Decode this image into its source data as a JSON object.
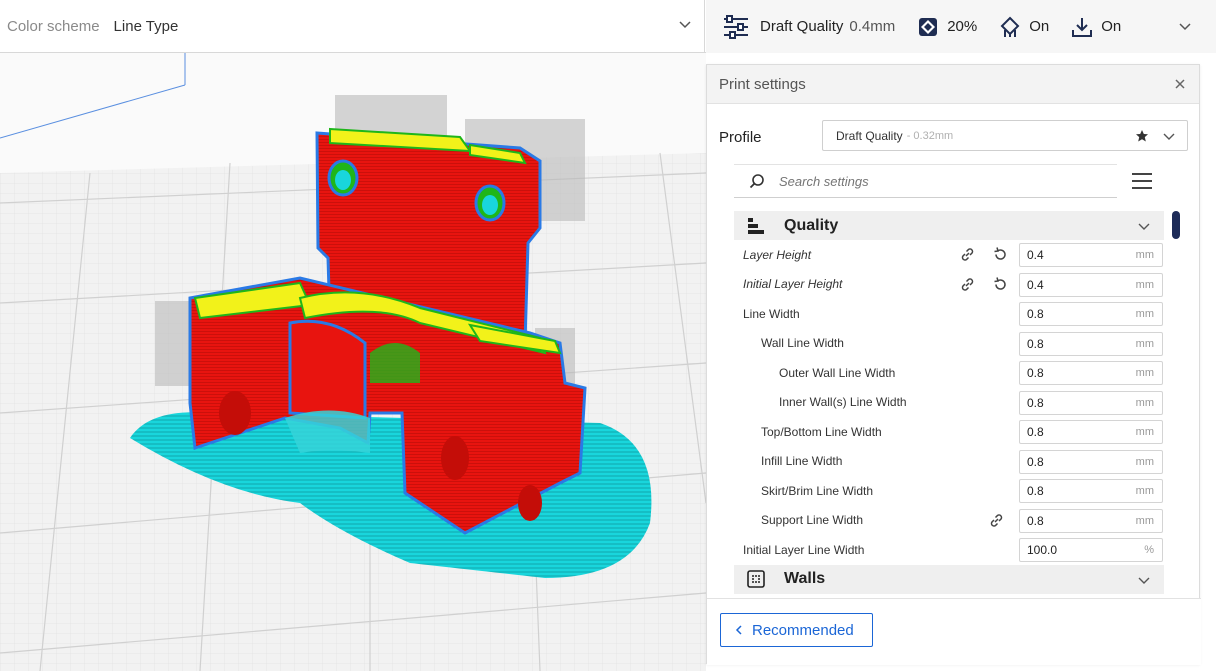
{
  "topbar": {
    "color_scheme_label": "Color scheme",
    "color_scheme_value": "Line Type",
    "quality": "Draft Quality",
    "layer": "0.4mm",
    "infill": "20%",
    "support": "On",
    "adhesion": "On"
  },
  "panel": {
    "title": "Print settings",
    "profile_label": "Profile",
    "profile_name": "Draft Quality",
    "profile_layer": "- 0.32mm",
    "search_placeholder": "Search settings",
    "categories": {
      "quality": "Quality",
      "walls": "Walls"
    },
    "rows": [
      {
        "label": "Layer Height",
        "value": "0.4",
        "unit": "mm"
      },
      {
        "label": "Initial Layer Height",
        "value": "0.4",
        "unit": "mm"
      },
      {
        "label": "Line Width",
        "value": "0.8",
        "unit": "mm"
      },
      {
        "label": "Wall Line Width",
        "value": "0.8",
        "unit": "mm"
      },
      {
        "label": "Outer Wall Line Width",
        "value": "0.8",
        "unit": "mm"
      },
      {
        "label": "Inner Wall(s) Line Width",
        "value": "0.8",
        "unit": "mm"
      },
      {
        "label": "Top/Bottom Line Width",
        "value": "0.8",
        "unit": "mm"
      },
      {
        "label": "Infill Line Width",
        "value": "0.8",
        "unit": "mm"
      },
      {
        "label": "Skirt/Brim Line Width",
        "value": "0.8",
        "unit": "mm"
      },
      {
        "label": "Support Line Width",
        "value": "0.8",
        "unit": "mm"
      },
      {
        "label": "Initial Layer Line Width",
        "value": "100.0",
        "unit": "%"
      }
    ],
    "recommended_label": "Recommended"
  },
  "colors": {
    "accent": "#1b66d6",
    "scrollbar": "#1d2b58",
    "wall_outer": "#e8140f",
    "wall_inner": "#1fb61a",
    "top_bottom": "#f2f21a",
    "skirt": "#19d6dc",
    "travel": "#2a7ae6"
  },
  "icons": {
    "print_setup": "sliders-icon",
    "infill": "infill-icon",
    "support": "support-icon",
    "adhesion": "adhesion-icon"
  }
}
